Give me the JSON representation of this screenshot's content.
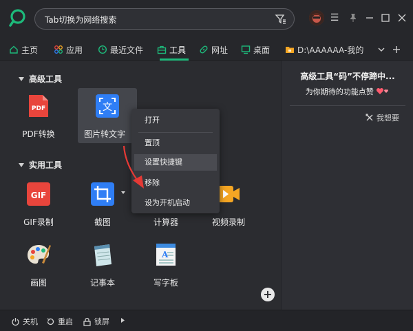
{
  "search": {
    "placeholder": "Tab切换为网络搜索"
  },
  "tabs": [
    {
      "label": "主页"
    },
    {
      "label": "应用"
    },
    {
      "label": "最近文件"
    },
    {
      "label": "工具"
    },
    {
      "label": "网址"
    },
    {
      "label": "桌面"
    },
    {
      "label": "D:\\AAAAAA-我的"
    }
  ],
  "sections": {
    "advanced": "高级工具",
    "practical": "实用工具"
  },
  "tools": {
    "pdf": "PDF转换",
    "img2text": "图片转文字",
    "gif": "GIF录制",
    "screenshot": "截图",
    "calculator": "计算器",
    "video": "视频录制",
    "paint": "画图",
    "notepad": "记事本",
    "wordpad": "写字板"
  },
  "icon_text": {
    "pdf": "PDF",
    "gif": "GIF",
    "wen": "文"
  },
  "context_menu": {
    "open": "打开",
    "pin": "置顶",
    "shortcut": "设置快捷键",
    "remove": "移除",
    "autostart": "设为开机启动"
  },
  "right_panel": {
    "title": "高级工具“码”不停蹄中...",
    "subtitle": "为你期待的功能点赞",
    "want": "我想要"
  },
  "statusbar": {
    "shutdown": "关机",
    "restart": "重启",
    "lock": "锁屏"
  },
  "colors": {
    "accent": "#1dba7b",
    "background": "#2b2c30",
    "pdf_red": "#e8453c",
    "blue": "#2f7ef5",
    "video_orange": "#f5a623"
  }
}
